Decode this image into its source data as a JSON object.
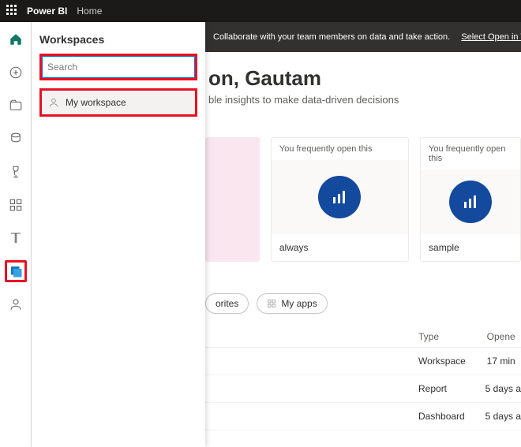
{
  "topbar": {
    "brand": "Power BI",
    "crumb": "Home"
  },
  "banner": {
    "text": "Collaborate with your team members on data and take action.",
    "link": "Select Open in Teams to get"
  },
  "flyout": {
    "title": "Workspaces",
    "search_placeholder": "Search",
    "my_workspace": "My workspace"
  },
  "main": {
    "title_suffix": "on, Gautam",
    "subtitle_suffix": "ble insights to make data-driven decisions"
  },
  "cards": [
    {
      "hint": "You frequently open this",
      "name": "always"
    },
    {
      "hint": "You frequently open this",
      "name": "sample"
    }
  ],
  "chips": {
    "favorites": "orites",
    "myapps": "My apps"
  },
  "table": {
    "headers": {
      "type": "Type",
      "opened": "Opene"
    },
    "rows": [
      {
        "type": "Workspace",
        "opened": "17 min"
      },
      {
        "type": "Report",
        "opened": "5 days a"
      },
      {
        "type": "Dashboard",
        "opened": "5 days a"
      }
    ]
  }
}
